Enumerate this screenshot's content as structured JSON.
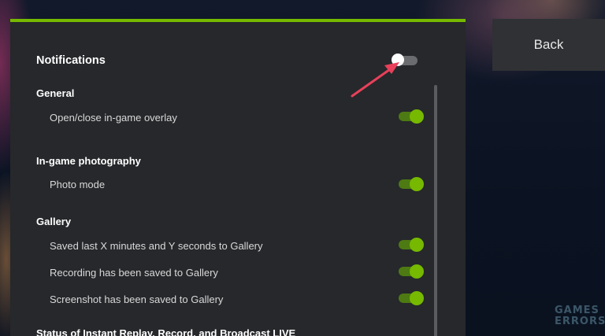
{
  "header": {
    "title": "Notifications",
    "back_label": "Back",
    "master_toggle": false
  },
  "sections": [
    {
      "title": "General",
      "items": [
        {
          "label": "Open/close in-game overlay",
          "enabled": true
        }
      ]
    },
    {
      "title": "In-game photography",
      "items": [
        {
          "label": "Photo mode",
          "enabled": true
        }
      ]
    },
    {
      "title": "Gallery",
      "items": [
        {
          "label": "Saved last X minutes and Y seconds to Gallery",
          "enabled": true
        },
        {
          "label": "Recording has been saved to Gallery",
          "enabled": true
        },
        {
          "label": "Screenshot has been saved to Gallery",
          "enabled": true
        }
      ]
    },
    {
      "title": "Status of Instant Replay, Record, and Broadcast LIVE",
      "items": []
    }
  ],
  "watermark": {
    "line1": "GAMES",
    "line2": "ERRORS"
  },
  "colors": {
    "accent": "#76b900",
    "annotation_arrow": "#e8405a"
  },
  "icons": {
    "annotation": "arrow-pointer-icon"
  }
}
